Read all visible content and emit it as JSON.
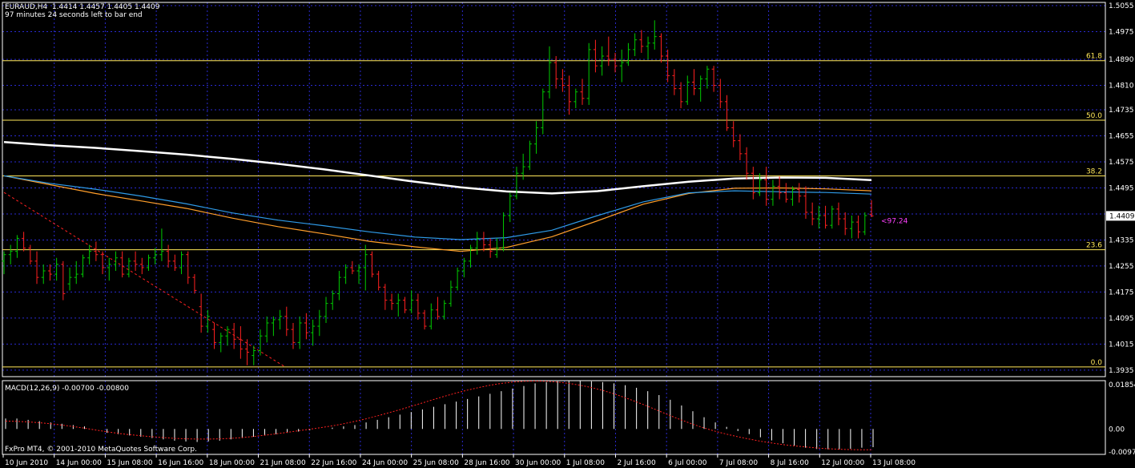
{
  "header": {
    "symbol_line": "EURAUD,H4  1.4414 1.4457 1.4405 1.4409",
    "timer_line": "97 minutes 24 seconds left to bar end"
  },
  "indicator": {
    "macd_label": "MACD(12,26,9) -0.00700 -0.00800"
  },
  "footer": {
    "copyright": "FxPro MT4, © 2001-2010 MetaQuotes Software Corp."
  },
  "colors": {
    "background": "#000000",
    "grid": "#2a2ad0",
    "fib": "#ffe75a",
    "ma_white": "#ffffff",
    "ma_blue": "#2f9be8",
    "ma_orange": "#ff9e2a",
    "bull": "#00cc00",
    "bear": "#ff2020",
    "trend": "#ff2020",
    "price_marker": "#ff40ff",
    "macd_signal": "#ff2020",
    "macd_hist": "#ffffff",
    "panel_border": "#ffffff"
  },
  "chart_data": {
    "type": "candlestick",
    "symbol": "EURAUD",
    "timeframe": "H4",
    "ohlc_current": {
      "open": 1.4414,
      "high": 1.4457,
      "low": 1.4405,
      "close": 1.4409
    },
    "y_ticks": [
      "1.5055",
      "1.4975",
      "1.4890",
      "1.4810",
      "1.4735",
      "1.4655",
      "1.4575",
      "1.4495",
      "1.4415",
      "1.4335",
      "1.4255",
      "1.4175",
      "1.4095",
      "1.4015",
      "1.3935"
    ],
    "ylim": [
      1.3915,
      1.5065
    ],
    "current_price": "1.4409",
    "x_ticks": [
      "10 Jun 2010",
      "14 Jun 00:00",
      "15 Jun 08:00",
      "16 Jun 16:00",
      "18 Jun 00:00",
      "21 Jun 08:00",
      "22 Jun 16:00",
      "24 Jun 00:00",
      "25 Jun 08:00",
      "28 Jun 16:00",
      "30 Jun 00:00",
      "1 Jul 08:00",
      "2 Jul 16:00",
      "6 Jul 00:00",
      "7 Jul 08:00",
      "8 Jul 16:00",
      "12 Jul 00:00",
      "13 Jul 08:00"
    ],
    "fibonacci": [
      {
        "label": "61.8",
        "price": 1.4886
      },
      {
        "label": "50.0",
        "price": 1.4703
      },
      {
        "label": "38.2",
        "price": 1.4532
      },
      {
        "label": "23.6",
        "price": 1.4305
      },
      {
        "label": "0.0",
        "price": 1.3945
      }
    ],
    "annotation": "<97.24",
    "ma_white": [
      1.4636,
      1.4626,
      1.4618,
      1.4608,
      1.4597,
      1.4584,
      1.4569,
      1.4552,
      1.4533,
      1.4514,
      1.4497,
      1.4484,
      1.4478,
      1.4485,
      1.45,
      1.4514,
      1.4524,
      1.4527,
      1.4526,
      1.4519
    ],
    "ma_blue": [
      1.4532,
      1.4509,
      1.4491,
      1.447,
      1.4446,
      1.4418,
      1.4396,
      1.4379,
      1.436,
      1.4344,
      1.4336,
      1.4342,
      1.4365,
      1.441,
      1.4452,
      1.448,
      1.4486,
      1.4483,
      1.4481,
      1.4476
    ],
    "ma_orange": [
      1.4532,
      1.4505,
      1.4478,
      1.4455,
      1.4432,
      1.4402,
      1.4376,
      1.4354,
      1.4331,
      1.4314,
      1.43,
      1.4312,
      1.4345,
      1.4394,
      1.4445,
      1.4478,
      1.4494,
      1.4495,
      1.4492,
      1.4486
    ],
    "trendline": [
      [
        1.4481,
        0
      ],
      [
        1.3945,
        0.324
      ]
    ],
    "candles": [
      [
        1.427,
        1.43,
        1.423,
        1.429
      ],
      [
        1.429,
        1.432,
        1.426,
        1.43
      ],
      [
        1.43,
        1.435,
        1.428,
        1.434
      ],
      [
        1.434,
        1.436,
        1.43,
        1.431
      ],
      [
        1.431,
        1.432,
        1.426,
        1.427
      ],
      [
        1.427,
        1.43,
        1.42,
        1.422
      ],
      [
        1.422,
        1.426,
        1.42,
        1.424
      ],
      [
        1.424,
        1.426,
        1.421,
        1.423
      ],
      [
        1.423,
        1.428,
        1.421,
        1.426
      ],
      [
        1.426,
        1.427,
        1.415,
        1.417
      ],
      [
        1.42,
        1.425,
        1.418,
        1.422
      ],
      [
        1.422,
        1.427,
        1.42,
        1.423
      ],
      [
        1.423,
        1.429,
        1.422,
        1.428
      ],
      [
        1.428,
        1.432,
        1.426,
        1.43
      ],
      [
        1.43,
        1.433,
        1.427,
        1.429
      ],
      [
        1.429,
        1.43,
        1.423,
        1.425
      ],
      [
        1.425,
        1.428,
        1.421,
        1.426
      ],
      [
        1.426,
        1.43,
        1.424,
        1.428
      ],
      [
        1.428,
        1.43,
        1.422,
        1.423
      ],
      [
        1.423,
        1.428,
        1.422,
        1.427
      ],
      [
        1.427,
        1.43,
        1.424,
        1.426
      ],
      [
        1.426,
        1.428,
        1.423,
        1.425
      ],
      [
        1.425,
        1.429,
        1.424,
        1.428
      ],
      [
        1.428,
        1.431,
        1.426,
        1.429
      ],
      [
        1.429,
        1.437,
        1.427,
        1.43
      ],
      [
        1.43,
        1.432,
        1.425,
        1.427
      ],
      [
        1.427,
        1.429,
        1.424,
        1.425
      ],
      [
        1.425,
        1.43,
        1.423,
        1.429
      ],
      [
        1.429,
        1.43,
        1.42,
        1.422
      ],
      [
        1.422,
        1.423,
        1.417,
        1.418
      ],
      [
        1.413,
        1.417,
        1.405,
        1.407
      ],
      [
        1.407,
        1.412,
        1.405,
        1.41
      ],
      [
        1.406,
        1.408,
        1.4,
        1.402
      ],
      [
        1.402,
        1.405,
        1.399,
        1.404
      ],
      [
        1.404,
        1.407,
        1.401,
        1.406
      ],
      [
        1.406,
        1.408,
        1.4,
        1.403
      ],
      [
        1.403,
        1.407,
        1.397,
        1.4
      ],
      [
        1.4,
        1.403,
        1.395,
        1.399
      ],
      [
        1.398,
        1.401,
        1.395,
        1.3995
      ],
      [
        1.3995,
        1.406,
        1.398,
        1.404
      ],
      [
        1.404,
        1.41,
        1.402,
        1.408
      ],
      [
        1.408,
        1.41,
        1.404,
        1.409
      ],
      [
        1.409,
        1.412,
        1.406,
        1.41
      ],
      [
        1.41,
        1.413,
        1.404,
        1.406
      ],
      [
        1.406,
        1.408,
        1.4,
        1.402
      ],
      [
        1.402,
        1.41,
        1.4,
        1.408
      ],
      [
        1.408,
        1.411,
        1.403,
        1.405
      ],
      [
        1.405,
        1.409,
        1.401,
        1.407
      ],
      [
        1.407,
        1.412,
        1.404,
        1.41
      ],
      [
        1.41,
        1.416,
        1.408,
        1.414
      ],
      [
        1.414,
        1.418,
        1.412,
        1.417
      ],
      [
        1.417,
        1.424,
        1.415,
        1.422
      ],
      [
        1.422,
        1.426,
        1.42,
        1.425
      ],
      [
        1.425,
        1.427,
        1.423,
        1.424
      ],
      [
        1.424,
        1.426,
        1.42,
        1.425
      ],
      [
        1.425,
        1.432,
        1.418,
        1.429
      ],
      [
        1.429,
        1.43,
        1.422,
        1.423
      ],
      [
        1.423,
        1.424,
        1.418,
        1.419
      ],
      [
        1.419,
        1.42,
        1.412,
        1.415
      ],
      [
        1.415,
        1.417,
        1.412,
        1.414
      ],
      [
        1.414,
        1.417,
        1.41,
        1.415
      ],
      [
        1.415,
        1.416,
        1.411,
        1.412
      ],
      [
        1.412,
        1.418,
        1.411,
        1.415
      ],
      [
        1.415,
        1.417,
        1.409,
        1.411
      ],
      [
        1.411,
        1.412,
        1.406,
        1.407
      ],
      [
        1.407,
        1.414,
        1.406,
        1.412
      ],
      [
        1.412,
        1.416,
        1.409,
        1.41
      ],
      [
        1.41,
        1.415,
        1.409,
        1.414
      ],
      [
        1.414,
        1.421,
        1.413,
        1.419
      ],
      [
        1.419,
        1.425,
        1.418,
        1.424
      ],
      [
        1.424,
        1.428,
        1.422,
        1.427
      ],
      [
        1.427,
        1.432,
        1.425,
        1.431
      ],
      [
        1.431,
        1.436,
        1.429,
        1.434
      ],
      [
        1.434,
        1.436,
        1.43,
        1.432
      ],
      [
        1.432,
        1.434,
        1.428,
        1.43
      ],
      [
        1.429,
        1.434,
        1.428,
        1.431
      ],
      [
        1.431,
        1.442,
        1.43,
        1.441
      ],
      [
        1.441,
        1.448,
        1.439,
        1.447
      ],
      [
        1.447,
        1.456,
        1.446,
        1.454
      ],
      [
        1.454,
        1.46,
        1.452,
        1.456
      ],
      [
        1.456,
        1.464,
        1.455,
        1.463
      ],
      [
        1.463,
        1.47,
        1.46,
        1.468
      ],
      [
        1.468,
        1.48,
        1.466,
        1.479
      ],
      [
        1.479,
        1.493,
        1.477,
        1.488
      ],
      [
        1.488,
        1.49,
        1.48,
        1.483
      ],
      [
        1.483,
        1.486,
        1.479,
        1.481
      ],
      [
        1.481,
        1.484,
        1.472,
        1.476
      ],
      [
        1.476,
        1.48,
        1.474,
        1.479
      ],
      [
        1.479,
        1.483,
        1.475,
        1.477
      ],
      [
        1.477,
        1.494,
        1.475,
        1.492
      ],
      [
        1.492,
        1.495,
        1.485,
        1.487
      ],
      [
        1.487,
        1.493,
        1.484,
        1.49
      ],
      [
        1.49,
        1.496,
        1.487,
        1.489
      ],
      [
        1.489,
        1.491,
        1.485,
        1.487
      ],
      [
        1.487,
        1.492,
        1.482,
        1.488
      ],
      [
        1.488,
        1.494,
        1.487,
        1.492
      ],
      [
        1.492,
        1.497,
        1.49,
        1.495
      ],
      [
        1.495,
        1.498,
        1.491,
        1.493
      ],
      [
        1.493,
        1.496,
        1.489,
        1.494
      ],
      [
        1.494,
        1.501,
        1.492,
        1.496
      ],
      [
        1.496,
        1.497,
        1.488,
        1.49
      ],
      [
        1.49,
        1.492,
        1.482,
        1.484
      ],
      [
        1.484,
        1.486,
        1.478,
        1.48
      ],
      [
        1.48,
        1.482,
        1.474,
        1.476
      ],
      [
        1.476,
        1.484,
        1.475,
        1.482
      ],
      [
        1.482,
        1.486,
        1.478,
        1.48
      ],
      [
        1.48,
        1.484,
        1.476,
        1.483
      ],
      [
        1.483,
        1.487,
        1.48,
        1.486
      ],
      [
        1.486,
        1.487,
        1.479,
        1.481
      ],
      [
        1.481,
        1.483,
        1.474,
        1.476
      ],
      [
        1.476,
        1.478,
        1.467,
        1.468
      ],
      [
        1.468,
        1.47,
        1.462,
        1.464
      ],
      [
        1.464,
        1.466,
        1.458,
        1.46
      ],
      [
        1.46,
        1.462,
        1.452,
        1.454
      ],
      [
        1.454,
        1.456,
        1.446,
        1.448
      ],
      [
        1.448,
        1.454,
        1.447,
        1.452
      ],
      [
        1.452,
        1.456,
        1.444,
        1.446
      ],
      [
        1.446,
        1.452,
        1.444,
        1.45
      ],
      [
        1.45,
        1.453,
        1.446,
        1.448
      ],
      [
        1.448,
        1.451,
        1.445,
        1.446
      ],
      [
        1.446,
        1.45,
        1.444,
        1.449
      ],
      [
        1.449,
        1.451,
        1.445,
        1.447
      ],
      [
        1.447,
        1.45,
        1.44,
        1.442
      ],
      [
        1.442,
        1.445,
        1.438,
        1.44
      ],
      [
        1.44,
        1.444,
        1.437,
        1.441
      ],
      [
        1.441,
        1.444,
        1.437,
        1.438
      ],
      [
        1.438,
        1.444,
        1.437,
        1.443
      ],
      [
        1.443,
        1.445,
        1.438,
        1.44
      ],
      [
        1.44,
        1.442,
        1.435,
        1.437
      ],
      [
        1.437,
        1.441,
        1.434,
        1.439
      ],
      [
        1.439,
        1.441,
        1.434,
        1.436
      ],
      [
        1.436,
        1.442,
        1.435,
        1.441
      ],
      [
        1.4414,
        1.4457,
        1.4405,
        1.4409
      ]
    ],
    "macd": {
      "y_ticks": [
        "0.01854",
        "0.00",
        "-0.00976"
      ],
      "ylim": [
        -0.00976,
        0.01854
      ],
      "histogram": [
        0.004,
        0.004,
        0.0035,
        0.003,
        0.0025,
        0.002,
        0.0015,
        0.001,
        0.0,
        -0.0015,
        -0.002,
        -0.0025,
        -0.003,
        -0.0035,
        -0.004,
        -0.0045,
        -0.0048,
        -0.005,
        -0.0048,
        -0.0045,
        -0.004,
        -0.0035,
        -0.003,
        -0.0025,
        -0.002,
        -0.0015,
        -0.001,
        -0.0005,
        0.0,
        0.0005,
        0.001,
        0.0015,
        0.0025,
        0.0035,
        0.0045,
        0.0055,
        0.0065,
        0.0075,
        0.0085,
        0.0095,
        0.0105,
        0.0115,
        0.0125,
        0.0135,
        0.0145,
        0.0155,
        0.0165,
        0.0175,
        0.018,
        0.0183,
        0.0185,
        0.0185,
        0.0183,
        0.018,
        0.0175,
        0.0168,
        0.0158,
        0.0145,
        0.013,
        0.0112,
        0.009,
        0.0068,
        0.0045,
        0.0025,
        0.0008,
        -0.0008,
        -0.002,
        -0.0032,
        -0.0044,
        -0.0055,
        -0.0065,
        -0.0072,
        -0.0077,
        -0.0078,
        -0.0078,
        -0.0076,
        -0.0072,
        -0.007
      ],
      "signal": [
        0.003,
        0.0029,
        0.0027,
        0.0024,
        0.002,
        0.0015,
        0.0009,
        0.0003,
        -0.0004,
        -0.0011,
        -0.0017,
        -0.0022,
        -0.0026,
        -0.003,
        -0.0033,
        -0.0036,
        -0.0038,
        -0.0039,
        -0.0039,
        -0.0038,
        -0.0036,
        -0.0033,
        -0.0029,
        -0.0024,
        -0.0019,
        -0.0013,
        -0.0007,
        -0.0001,
        0.0005,
        0.0012,
        0.002,
        0.0029,
        0.0039,
        0.005,
        0.0062,
        0.0074,
        0.0087,
        0.01,
        0.0113,
        0.0126,
        0.0138,
        0.0149,
        0.0159,
        0.0168,
        0.0175,
        0.018,
        0.0183,
        0.0184,
        0.0183,
        0.018,
        0.0175,
        0.0168,
        0.0159,
        0.0148,
        0.0135,
        0.012,
        0.0104,
        0.0087,
        0.0069,
        0.0051,
        0.0034,
        0.0018,
        0.0004,
        -0.0009,
        -0.002,
        -0.003,
        -0.0039,
        -0.0047,
        -0.0054,
        -0.006,
        -0.0065,
        -0.0069,
        -0.0073,
        -0.0076,
        -0.0078,
        -0.0079,
        -0.008,
        -0.008
      ]
    }
  }
}
